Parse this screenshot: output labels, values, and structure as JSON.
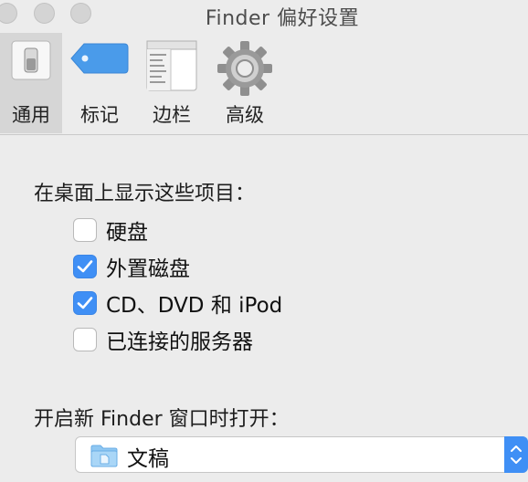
{
  "window": {
    "title": "Finder 偏好设置"
  },
  "toolbar": {
    "tabs": [
      {
        "label": "通用",
        "icon": "general-switch-icon",
        "selected": true
      },
      {
        "label": "标记",
        "icon": "tag-icon",
        "selected": false
      },
      {
        "label": "边栏",
        "icon": "sidebar-icon",
        "selected": false
      },
      {
        "label": "高级",
        "icon": "gear-icon",
        "selected": false
      }
    ]
  },
  "desktop_section": {
    "heading": "在桌面上显示这些项目：",
    "items": [
      {
        "label": "硬盘",
        "checked": false
      },
      {
        "label": "外置磁盘",
        "checked": true
      },
      {
        "label": "CD、DVD 和 iPod",
        "checked": true
      },
      {
        "label": "已连接的服务器",
        "checked": false
      }
    ]
  },
  "new_window_section": {
    "heading": "开启新 Finder 窗口时打开：",
    "selected": "文稿",
    "icon": "folder-icon"
  },
  "colors": {
    "accent": "#3f8ff5",
    "window_bg": "#ececec",
    "tag_blue": "#4a9bea"
  }
}
